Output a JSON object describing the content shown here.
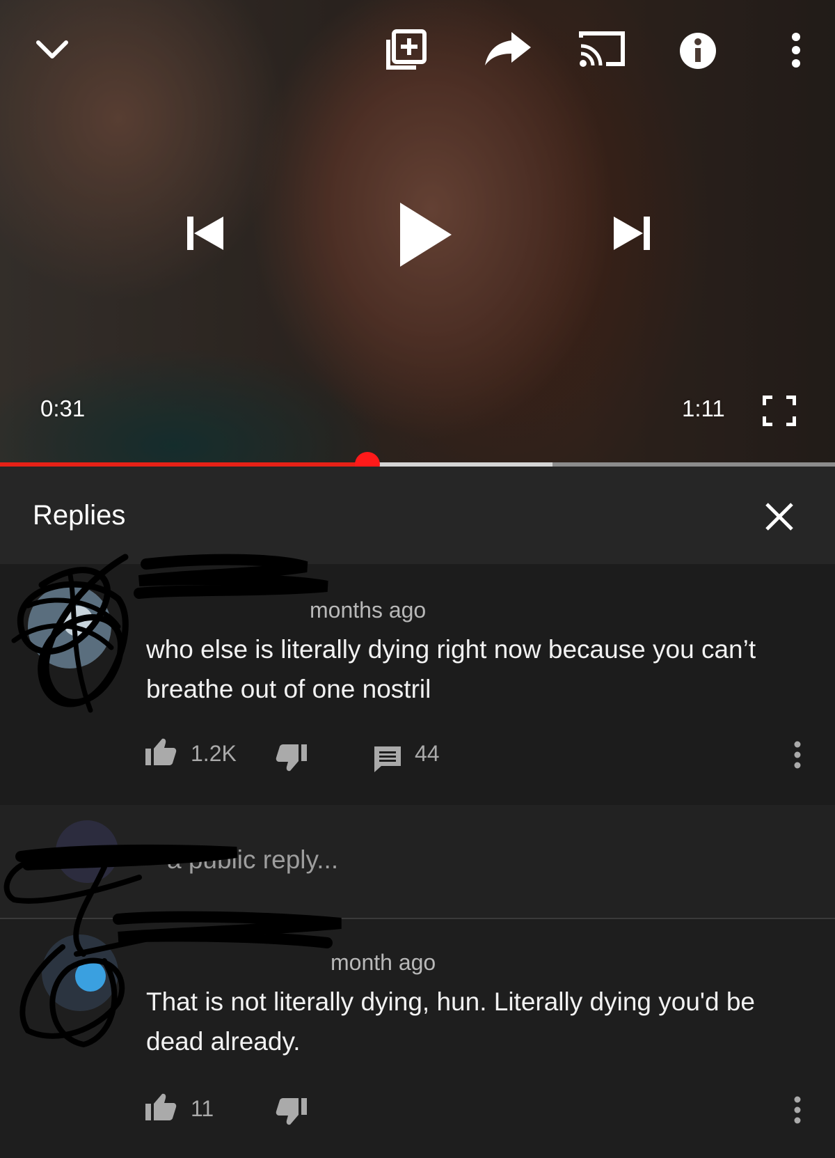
{
  "player": {
    "current_time": "0:31",
    "duration": "1:11",
    "progress_played": 0.44,
    "progress_buffered": 0.662
  },
  "replies_panel": {
    "title": "Replies"
  },
  "parent_comment": {
    "meta": "months ago",
    "text": "who else is literally dying right now because you can’t breathe out of one nostril",
    "likes": "1.2K",
    "reply_count": "44"
  },
  "reply_input": {
    "placeholder": "a public reply..."
  },
  "child_comment": {
    "meta": "month ago",
    "text": "That is not literally dying, hun. Literally dying you'd be dead already.",
    "likes": "11"
  },
  "icons": {
    "collapse": "chevron-down-icon",
    "add_to_playlist": "add-to-playlist-icon",
    "share": "share-icon",
    "cast": "cast-icon",
    "info": "info-icon",
    "more": "more-vert-icon",
    "previous": "skip-previous-icon",
    "play": "play-icon",
    "next": "skip-next-icon",
    "fullscreen": "fullscreen-icon",
    "close": "close-icon",
    "like": "thumb-up-icon",
    "dislike": "thumb-down-icon",
    "replies": "comment-icon"
  },
  "colors": {
    "progress_played": "#e62117",
    "panel_bg": "#212121"
  }
}
